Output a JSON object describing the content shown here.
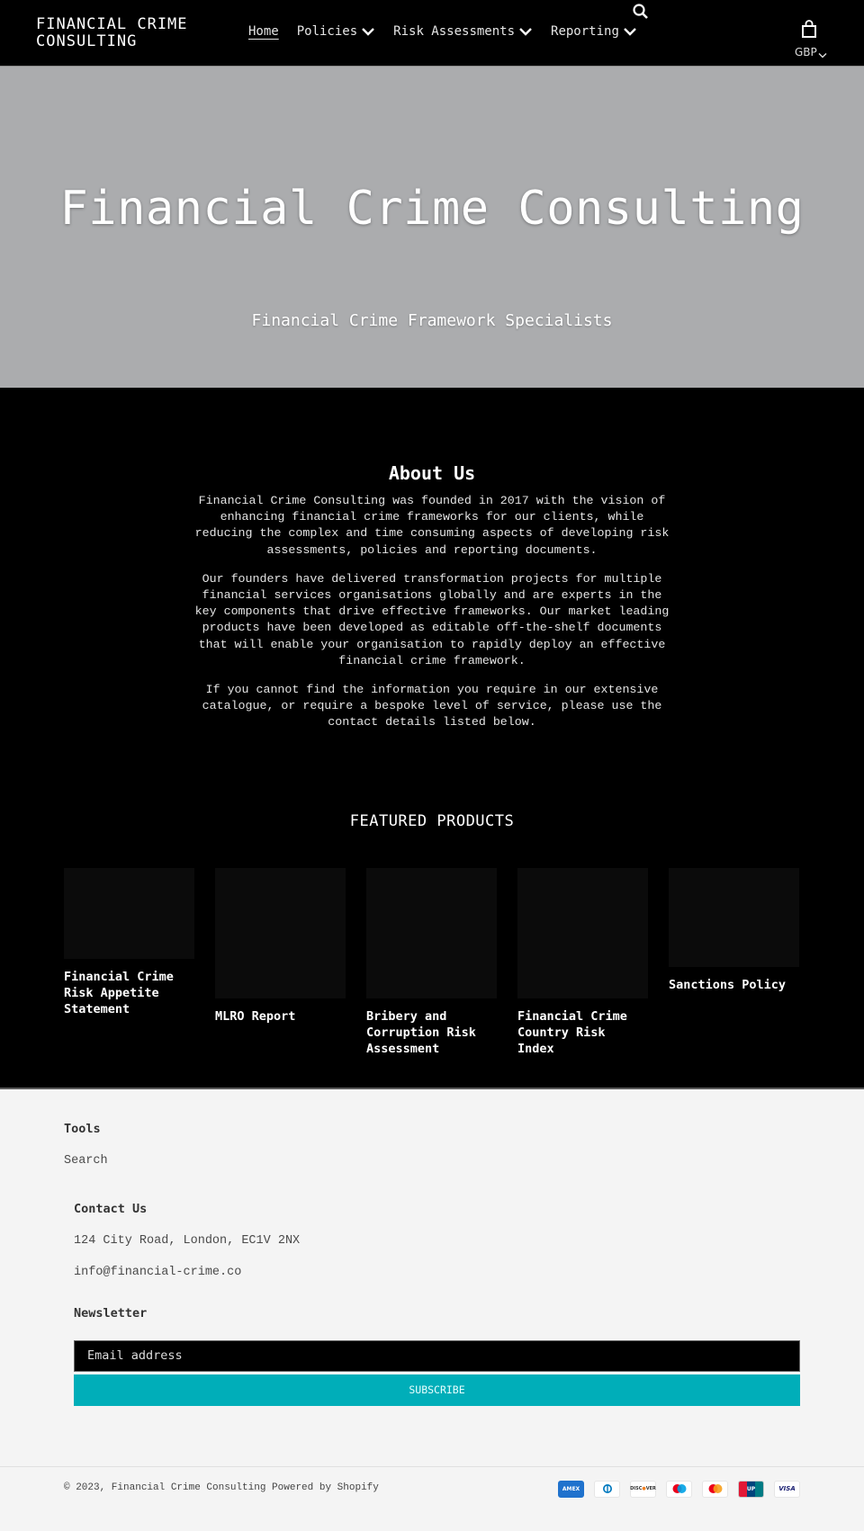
{
  "header": {
    "logo": "FINANCIAL CRIME CONSULTING",
    "nav": [
      {
        "label": "Home",
        "active": true,
        "dropdown": false
      },
      {
        "label": "Policies",
        "active": false,
        "dropdown": true
      },
      {
        "label": "Risk Assessments",
        "active": false,
        "dropdown": true
      },
      {
        "label": "Reporting",
        "active": false,
        "dropdown": true
      }
    ],
    "search_icon": "search-icon",
    "cart_icon": "shopping-bag-icon",
    "currency": "GBP"
  },
  "hero": {
    "title": "Financial Crime Consulting",
    "subtitle": "Financial Crime Framework Specialists",
    "background_color": "#abacae"
  },
  "about": {
    "heading": "About Us",
    "paragraphs": [
      "Financial Crime Consulting was founded in 2017 with the vision of enhancing financial crime frameworks for our clients, while reducing the complex and time consuming aspects of developing risk assessments, policies and reporting documents.",
      "Our founders have delivered transformation projects for multiple financial services organisations globally and are experts in the key components that drive effective frameworks. Our market leading products have been developed as editable off-the-shelf documents that will enable your organisation to rapidly deploy an effective financial crime framework.",
      "If you cannot find the information you require in our extensive catalogue, or require a bespoke level of service, please use the contact details listed below."
    ]
  },
  "featured": {
    "heading": "FEATURED PRODUCTS",
    "products": [
      {
        "title": "Financial Crime Risk Appetite Statement"
      },
      {
        "title": "MLRO Report"
      },
      {
        "title": "Bribery and Corruption Risk Assessment"
      },
      {
        "title": "Financial Crime Country Risk Index"
      },
      {
        "title": "Sanctions Policy"
      }
    ]
  },
  "footer": {
    "tools_heading": "Tools",
    "tools_links": [
      "Search"
    ],
    "contact_heading": "Contact Us",
    "address": "124 City Road, London, EC1V 2NX",
    "email": "info@financial-crime.co",
    "newsletter_heading": "Newsletter",
    "email_placeholder": "Email address",
    "subscribe_label": "SUBSCRIBE",
    "accent_color": "#00aeb9",
    "copyright": "© 2023, Financial Crime Consulting",
    "powered_by": "Powered by Shopify",
    "payment_methods": [
      "American Express",
      "Diners Club",
      "Discover",
      "Maestro",
      "Mastercard",
      "UnionPay",
      "Visa"
    ]
  }
}
